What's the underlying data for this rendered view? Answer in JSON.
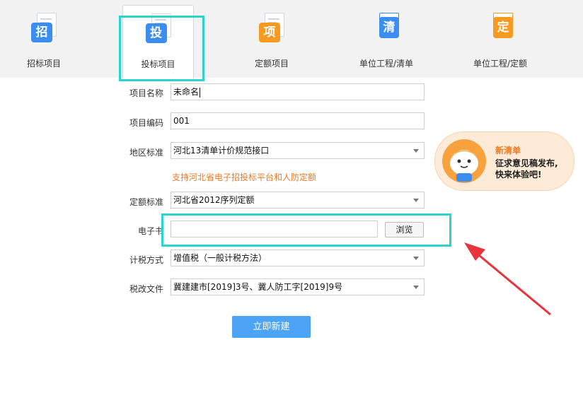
{
  "tabs": [
    {
      "label": "招标项目",
      "icon_char": "招",
      "icon": "document-bid-icon",
      "color": "blue"
    },
    {
      "label": "投标项目",
      "icon_char": "投",
      "icon": "document-tender-icon",
      "color": "blue"
    },
    {
      "label": "定额项目",
      "icon_char": "项",
      "icon": "document-quota-icon",
      "color": "orange"
    },
    {
      "label": "单位工程/清单",
      "icon_char": "清",
      "icon": "notebook-list-icon",
      "color": "blue"
    },
    {
      "label": "单位工程/定额",
      "icon_char": "定",
      "icon": "notebook-quota-icon",
      "color": "orange"
    }
  ],
  "active_tab": "投标项目",
  "form": {
    "project_name_label": "项目名称",
    "project_name_value": "未命名",
    "project_code_label": "项目编码",
    "project_code_value": "001",
    "region_label": "地区标准",
    "region_value": "河北13清单计价规范接口",
    "region_note": "支持河北省电子招投标平台和人防定额",
    "quota_label": "定额标准",
    "quota_value": "河北省2012序列定额",
    "ebid_label": "电子书",
    "ebid_value": "",
    "browse_label": "浏览",
    "tax_label": "计税方式",
    "tax_value": "增值税（一般计税方法）",
    "taxdoc_label": "税改文件",
    "taxdoc_value": "冀建建市[2019]3号、冀人防工字[2019]9号",
    "create_label": "立即新建"
  },
  "promo": {
    "title": "新清单",
    "line1": "征求意见稿发布,",
    "line2": "快来体验吧!"
  },
  "colors": {
    "highlight": "#2dd4cf",
    "arrow": "#e8333a",
    "primary": "#4da3f5",
    "note": "#e8792b"
  }
}
